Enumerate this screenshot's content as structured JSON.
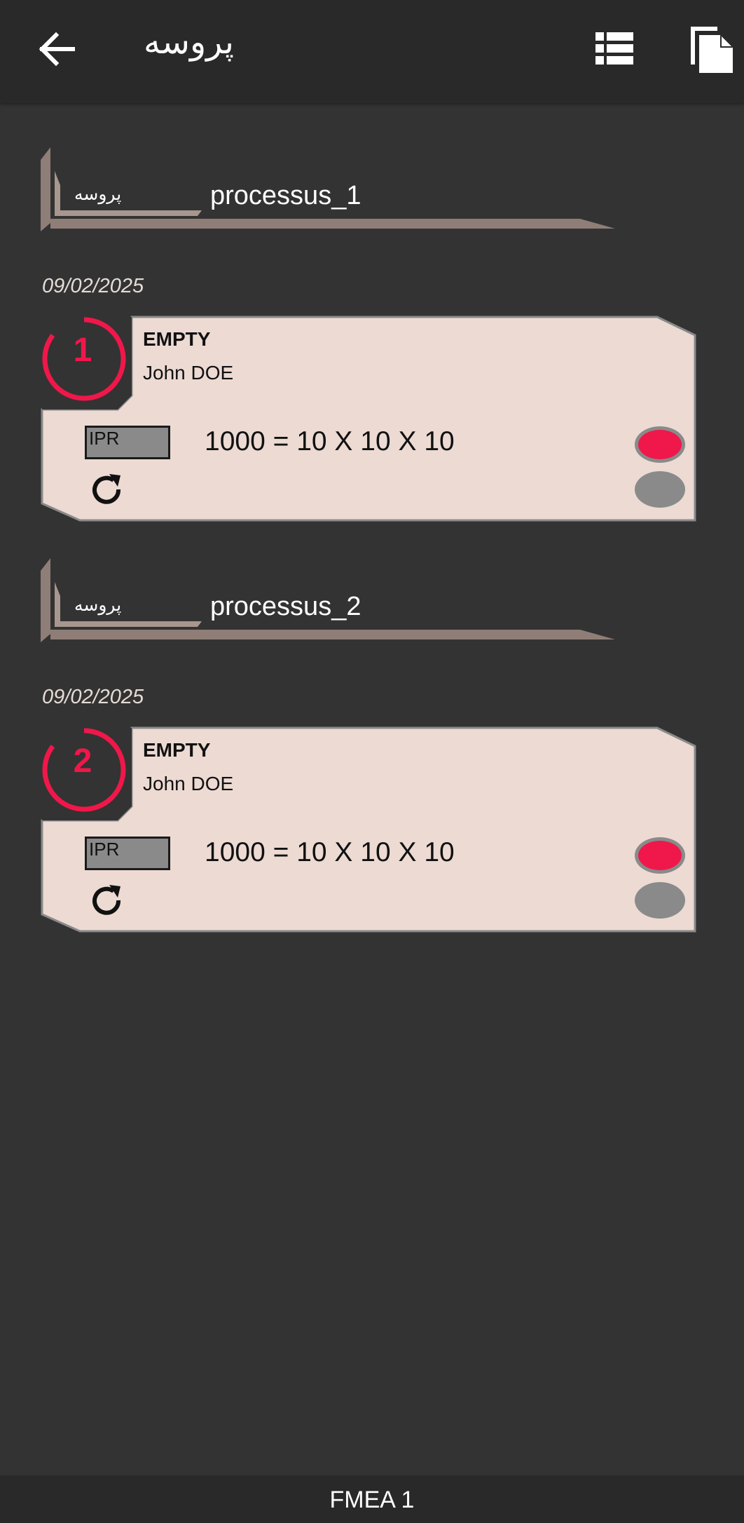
{
  "appbar": {
    "title": "پروسه",
    "back_icon": "arrow-left-icon",
    "list_icon": "list-view-icon",
    "copy_icon": "copy-icon"
  },
  "processes": [
    {
      "label_small": "پروسه",
      "name": "processus_1",
      "date": "09/02/2025",
      "card": {
        "number": "1",
        "status": "EMPTY",
        "owner": "John DOE",
        "ipr_label": "IPR",
        "formula": "1000 = 10 X 10 X 10"
      }
    },
    {
      "label_small": "پروسه",
      "name": "processus_2",
      "date": "09/02/2025",
      "card": {
        "number": "2",
        "status": "EMPTY",
        "owner": "John DOE",
        "ipr_label": "IPR",
        "formula": "1000 = 10 X 10 X 10"
      }
    }
  ],
  "footer": {
    "label": "FMEA 1"
  },
  "colors": {
    "background": "#333333",
    "appbar": "#292929",
    "card": "#ecdad3",
    "accent": "#f0174a",
    "frame": "#8f7e77",
    "inactive": "#8a8a8a"
  }
}
